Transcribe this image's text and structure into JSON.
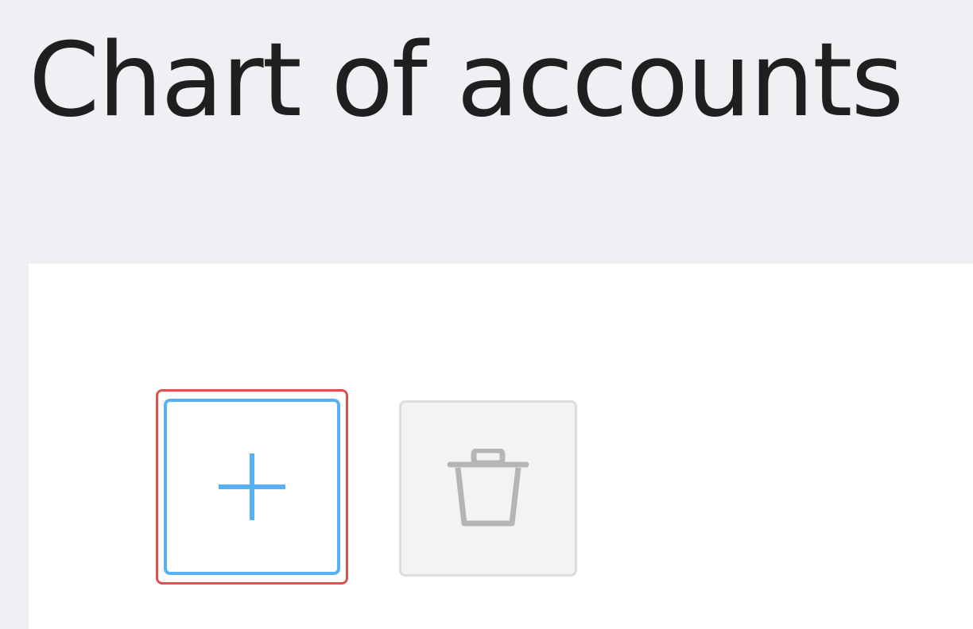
{
  "header": {
    "title": "Chart of accounts"
  },
  "toolbar": {
    "buttons": [
      {
        "name": "add",
        "icon": "plus-icon",
        "state": "focused",
        "accent_color": "#58b1f3"
      },
      {
        "name": "delete",
        "icon": "trash-icon",
        "state": "disabled",
        "accent_color": "#b5b5b5"
      }
    ]
  },
  "colors": {
    "page_background": "#eff0f4",
    "panel_background": "#ffffff",
    "focus_ring": "#d9534f"
  }
}
